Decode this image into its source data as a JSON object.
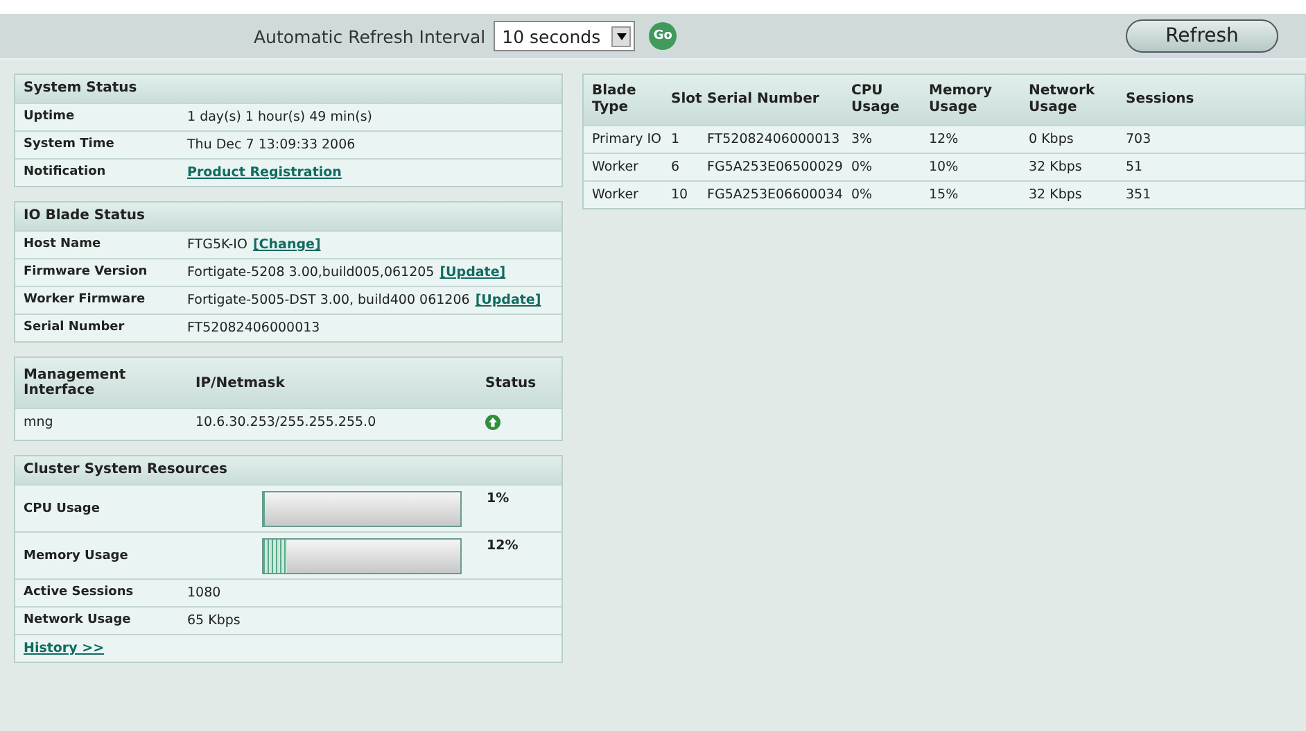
{
  "toolbar": {
    "label": "Automatic Refresh Interval",
    "interval": "10 seconds",
    "go": "Go",
    "refresh": "Refresh"
  },
  "system_status": {
    "title": "System Status",
    "rows": [
      {
        "label": "Uptime",
        "value": "1 day(s) 1 hour(s) 49 min(s)"
      },
      {
        "label": "System Time",
        "value": "Thu Dec 7 13:09:33 2006"
      },
      {
        "label": "Notification",
        "link": "Product Registration"
      }
    ]
  },
  "io_blade_status": {
    "title": "IO Blade Status",
    "rows": [
      {
        "label": "Host Name",
        "value": "FTG5K-IO",
        "link": "[Change]"
      },
      {
        "label": "Firmware Version",
        "value": "Fortigate-5208 3.00,build005,061205",
        "link": "[Update]"
      },
      {
        "label": "Worker Firmware",
        "value": "Fortigate-5005-DST 3.00, build400 061206",
        "link": "[Update]"
      },
      {
        "label": "Serial Number",
        "value": "FT52082406000013"
      }
    ]
  },
  "management": {
    "columns": [
      "Management Interface",
      "IP/Netmask",
      "Status"
    ],
    "rows": [
      {
        "interface": "mng",
        "ip": "10.6.30.253/255.255.255.0",
        "status_up": true
      }
    ]
  },
  "cluster_resources": {
    "title": "Cluster System Resources",
    "meters": [
      {
        "label": "CPU Usage",
        "level": 0.01,
        "reading": "1%"
      },
      {
        "label": "Memory Usage",
        "level": 0.12,
        "reading": "12%"
      }
    ],
    "rows": [
      {
        "label": "Active Sessions",
        "value": "1080"
      },
      {
        "label": "Network Usage",
        "value": "65 Kbps"
      }
    ],
    "history": "History >>"
  },
  "blades": {
    "columns": [
      "Blade Type",
      "Slot",
      "Serial Number",
      "CPU Usage",
      "Memory Usage",
      "Network Usage",
      "Sessions"
    ],
    "rows": [
      [
        "Primary IO",
        "1",
        "FT52082406000013",
        "3%",
        "12%",
        "0 Kbps",
        "703"
      ],
      [
        "Worker",
        "6",
        "FG5A253E06500029",
        "0%",
        "10%",
        "32 Kbps",
        "51"
      ],
      [
        "Worker",
        "10",
        "FG5A253E06600034",
        "0%",
        "15%",
        "32 Kbps",
        "351"
      ]
    ]
  }
}
